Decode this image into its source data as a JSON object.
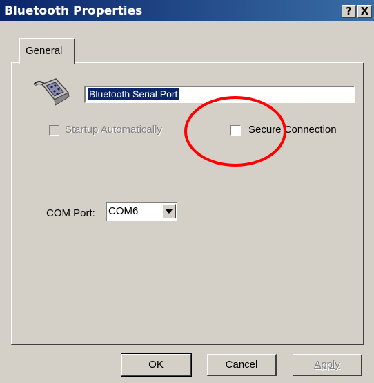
{
  "window": {
    "title": "Bluetooth Properties",
    "help_label": "?",
    "close_label": "X"
  },
  "tabs": [
    {
      "label": "General"
    }
  ],
  "general": {
    "device_name": "Bluetooth Serial Port",
    "startup_label": "Startup Automatically",
    "startup_checked": false,
    "startup_enabled": false,
    "secure_label": "Secure Connection",
    "secure_checked": false,
    "com_label": "COM Port:",
    "com_value": "COM6"
  },
  "buttons": {
    "ok": "OK",
    "cancel": "Cancel",
    "apply": "Apply"
  },
  "colors": {
    "title_bar": "#0a246a",
    "face": "#d4d0c8",
    "annotation": "#ff0000"
  },
  "icons": {
    "port_icon": "serial-port-icon",
    "combo_arrow": "chevron-down-icon",
    "annotation": "red-circle-annotation"
  }
}
